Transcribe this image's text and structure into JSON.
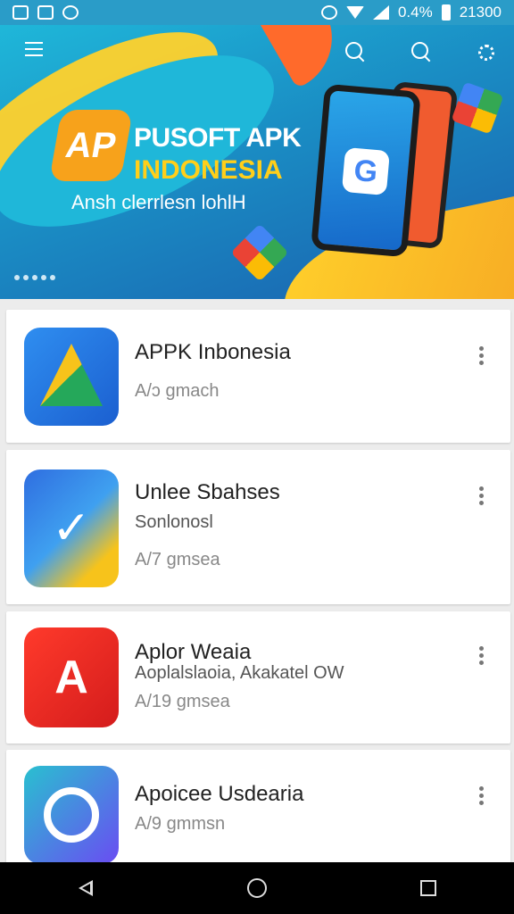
{
  "status": {
    "battery_percent": "0.4%",
    "time": "21300"
  },
  "banner": {
    "title": "PUSOFT APK",
    "subtitle": "INDONESIA",
    "tagline": "Ansh clerrlesn lohlH",
    "logo_glyph": "AP",
    "phone_glyph": "G"
  },
  "apps": [
    {
      "name": "APPK Inbonesia",
      "sub": "",
      "meta": "A/ɔ gmach"
    },
    {
      "name": "Unlee Sbahses",
      "sub": "Sonlonosl",
      "meta": "A/7 gmsea"
    },
    {
      "name": "Aplor Weaia",
      "sub": "Aoplalslaoia, Akakatel OW",
      "meta": "A/19 gmsea"
    },
    {
      "name": "Apoicee Usdearia",
      "sub": "",
      "meta": "A/9 gmmsn"
    }
  ],
  "colors": {
    "accent": "#1a8dc4",
    "banner_yellow": "#ffd12b",
    "card_bg": "#ffffff"
  }
}
